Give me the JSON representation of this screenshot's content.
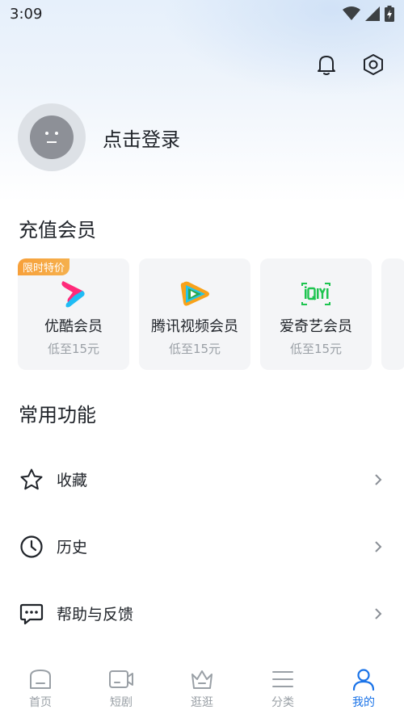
{
  "status_bar": {
    "time": "3:09"
  },
  "profile": {
    "login_text": "点击登录"
  },
  "vip_section": {
    "title": "充值会员",
    "cards": [
      {
        "badge": "限时特价",
        "name": "优酷会员",
        "price": "低至15元",
        "logo": "youku-icon"
      },
      {
        "name": "腾讯视频会员",
        "price": "低至15元",
        "logo": "tencent-video-icon"
      },
      {
        "name": "爱奇艺会员",
        "price": "低至15元",
        "logo": "iqiyi-icon"
      }
    ]
  },
  "functions_section": {
    "title": "常用功能",
    "items": [
      {
        "label": "收藏",
        "icon": "star-icon"
      },
      {
        "label": "历史",
        "icon": "clock-icon"
      },
      {
        "label": "帮助与反馈",
        "icon": "chat-icon"
      }
    ]
  },
  "tabbar": {
    "tabs": [
      {
        "label": "首页",
        "icon": "home-icon"
      },
      {
        "label": "短剧",
        "icon": "video-icon"
      },
      {
        "label": "逛逛",
        "icon": "crown-icon"
      },
      {
        "label": "分类",
        "icon": "menu-icon"
      },
      {
        "label": "我的",
        "icon": "user-icon",
        "active": true
      }
    ]
  },
  "colors": {
    "accent": "#1a73e8",
    "badge": "#f7a03a",
    "muted": "#9aa0a6"
  }
}
